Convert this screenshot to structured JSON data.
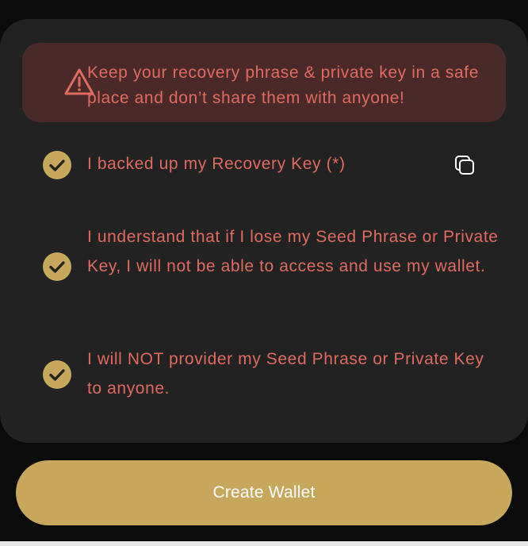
{
  "warning": {
    "icon": "warning-triangle-icon",
    "text": "Keep your recovery phrase & private key in a safe place and don’t share them with anyone!",
    "color": "#e06b5f",
    "background": "#4a2a28"
  },
  "checklist": {
    "items": [
      {
        "label": "I backed up my Recovery Key (*)",
        "checked": true,
        "has_copy_icon": true
      },
      {
        "label": "I understand that if I lose my Seed Phrase or Private Key, I will not be able to access and use my wallet.",
        "checked": true
      },
      {
        "label": "I will NOT provider my Seed Phrase or Private Key to anyone.",
        "checked": true
      }
    ],
    "text_color": "#df6b5f",
    "check_color": "#c6a75c"
  },
  "actions": {
    "create_wallet_label": "Create Wallet",
    "button_color": "#c6a75c"
  },
  "icons": {
    "copy": "copy-icon",
    "check": "check-circle-icon"
  }
}
